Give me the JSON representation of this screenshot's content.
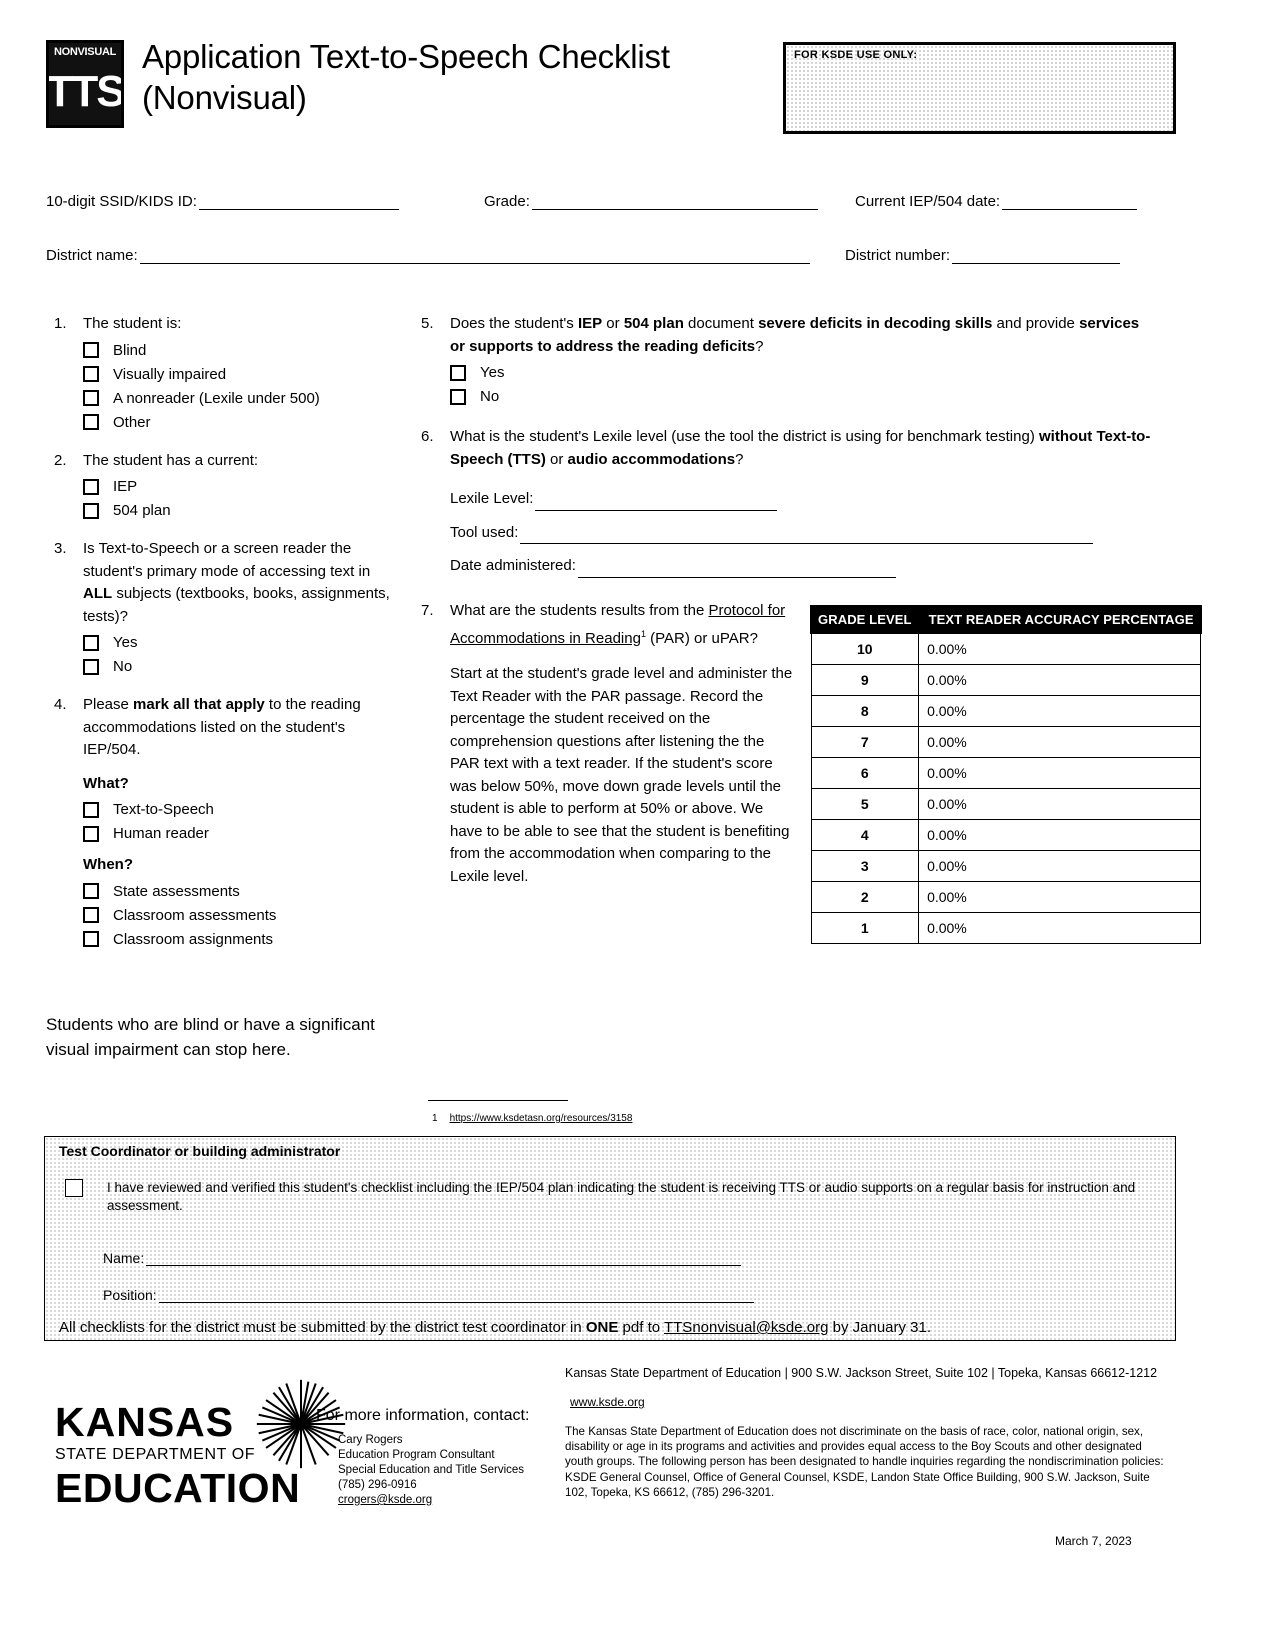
{
  "header": {
    "logo_top": "NONVISUAL",
    "logo_main": "TTS",
    "title": "Application Text-to-Speech Checklist (Nonvisual)",
    "ksde_box_label": "FOR KSDE USE ONLY:"
  },
  "id_fields": {
    "ssid_label": "10-digit SSID/KIDS ID:",
    "grade_label": "Grade:",
    "iep_date_label": "Current IEP/504 date:",
    "district_name_label": "District name:",
    "district_number_label": "District number:"
  },
  "questions": {
    "q1": {
      "num": "1.",
      "text": "The student is:",
      "options": [
        "Blind",
        "Visually impaired",
        "A nonreader (Lexile under 500)",
        "Other"
      ]
    },
    "q2": {
      "num": "2.",
      "text": "The student has a current:",
      "options": [
        "IEP",
        "504 plan"
      ]
    },
    "q3": {
      "num": "3.",
      "text_a": "Is Text-to-Speech or a screen reader the student's primary mode of accessing text in ",
      "text_bold": "ALL",
      "text_b": " subjects (textbooks, books, assignments, tests)?",
      "options": [
        "Yes",
        "No"
      ]
    },
    "q4": {
      "num": "4.",
      "text_a": "Please ",
      "text_bold": "mark all that apply",
      "text_b": " to the reading accommodations listed on the student's IEP/504.",
      "what_label": "What?",
      "what_options": [
        "Text-to-Speech",
        "Human reader"
      ],
      "when_label": "When?",
      "when_options": [
        "State assessments",
        "Classroom assessments",
        "Classroom assignments"
      ]
    },
    "q5": {
      "num": "5.",
      "text_a": "Does the student's ",
      "bold1": "IEP",
      "text_b": " or ",
      "bold2": "504 plan",
      "text_c": " document ",
      "bold3": "severe deficits in decoding skills",
      "text_d": " and provide ",
      "bold4": "services or supports to address the reading deficits",
      "text_e": "?",
      "options": [
        "Yes",
        "No"
      ]
    },
    "q6": {
      "num": "6.",
      "text_a": "What is the student's Lexile level (use the tool the district is using for benchmark testing) ",
      "bold1": "without Text-to-Speech (TTS)",
      "text_b": " or ",
      "bold2": "audio accommodations",
      "text_c": "?",
      "lexile_label": "Lexile Level:",
      "tool_label": "Tool used:",
      "date_label": "Date administered:"
    },
    "q7": {
      "num": "7.",
      "text_a": "What are the students results from the ",
      "link": "Protocol for Accommodations in Reading",
      "sup": "1",
      "text_b": " (PAR) or uPAR?",
      "paragraph": "Start at the student's grade level and administer the Text Reader with the PAR passage. Record the percentage the student received on the comprehension questions after listening the the PAR text with a text reader. If the student's score was below 50%, move down grade levels until the student is able to perform at 50% or above. We have to be able to see that the student is benefiting from the accommodation when comparing to the Lexile level."
    }
  },
  "stop_here": "Students who are blind or have a significant visual impairment can stop here.",
  "table": {
    "headers": [
      "GRADE LEVEL",
      "TEXT READER ACCURACY PERCENTAGE"
    ],
    "rows": [
      {
        "grade": "10",
        "pct": "0.00%"
      },
      {
        "grade": "9",
        "pct": "0.00%"
      },
      {
        "grade": "8",
        "pct": "0.00%"
      },
      {
        "grade": "7",
        "pct": "0.00%"
      },
      {
        "grade": "6",
        "pct": "0.00%"
      },
      {
        "grade": "5",
        "pct": "0.00%"
      },
      {
        "grade": "4",
        "pct": "0.00%"
      },
      {
        "grade": "3",
        "pct": "0.00%"
      },
      {
        "grade": "2",
        "pct": "0.00%"
      },
      {
        "grade": "1",
        "pct": "0.00%"
      }
    ]
  },
  "footnote": {
    "num": "1",
    "url": "https://www.ksdetasn.org/resources/3158"
  },
  "coordinator": {
    "title": "Test Coordinator or building administrator",
    "attestation": "I have reviewed and verified this student's checklist including the IEP/504 plan indicating the student is receiving TTS or audio supports on a regular basis for instruction and assessment.",
    "name_label": "Name:",
    "position_label": "Position:",
    "submit_a": "All checklists for the district must be submitted by the district test coordinator in ",
    "submit_bold": "ONE",
    "submit_b": " pdf to ",
    "submit_email": "TTSnonvisual@ksde.org",
    "submit_c": " by January 31."
  },
  "footer": {
    "logo_line1": "KANSAS",
    "logo_line2": "STATE DEPARTMENT OF",
    "logo_line3": "EDUCATION",
    "contact_head": "For more information, contact:",
    "contact_name": "Cary Rogers",
    "contact_title": "Education Program Consultant",
    "contact_dept": "Special Education and Title Services",
    "contact_phone": "(785) 296-0916",
    "contact_email": "crogers@ksde.org",
    "address": "Kansas State Department of Education | 900 S.W. Jackson Street, Suite 102 | Topeka, Kansas 66612-1212",
    "website": "www.ksde.org",
    "nondiscrimination": "The Kansas State Department of Education does not discriminate on the basis of race, color, national origin, sex, disability or age in its programs and activities and provides equal access to the Boy Scouts and other designated youth groups. The following person has been designated to handle inquiries regarding the nondiscrimination policies: KSDE General Counsel, Office of General Counsel, KSDE, Landon State Office Building, 900 S.W. Jackson, Suite 102, Topeka, KS 66612, (785) 296-3201.",
    "date": "March 7, 2023"
  }
}
